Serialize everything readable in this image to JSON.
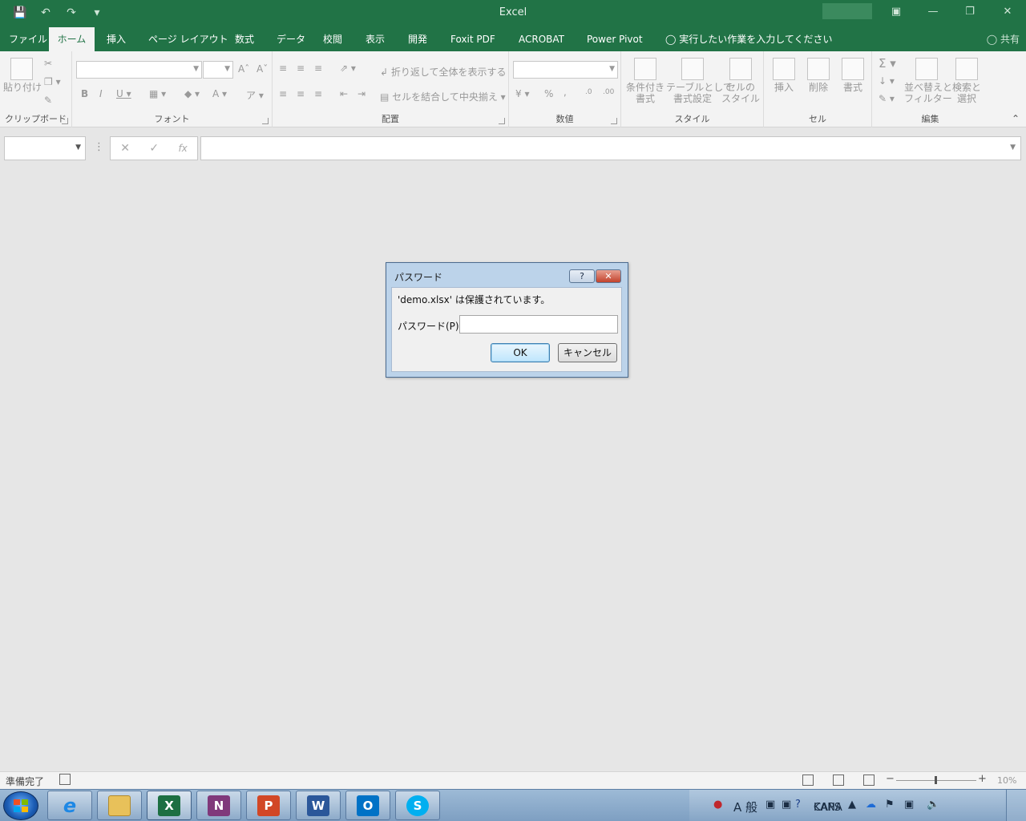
{
  "window": {
    "title": "Excel",
    "share_label": "共有"
  },
  "tabs": [
    "ファイル",
    "ホーム",
    "挿入",
    "ページ レイアウト",
    "数式",
    "データ",
    "校閲",
    "表示",
    "開発",
    "Foxit PDF",
    "ACROBAT",
    "Power Pivot",
    "実行したい作業を入力してください"
  ],
  "ribbon": {
    "clipboard": {
      "label": "クリップボード",
      "paste": "貼り付け"
    },
    "font": {
      "label": "フォント"
    },
    "alignment": {
      "label": "配置",
      "wrap": "折り返して全体を表示する",
      "merge": "セルを結合して中央揃え"
    },
    "number": {
      "label": "数値",
      "percent": "%",
      "comma": ","
    },
    "styles": {
      "label": "スタイル",
      "conditional_1": "条件付き",
      "conditional_2": "書式",
      "table_1": "テーブルとして",
      "table_2": "書式設定",
      "cell_1": "セルの",
      "cell_2": "スタイル"
    },
    "cells": {
      "label": "セル",
      "insert": "挿入",
      "delete": "削除",
      "format": "書式"
    },
    "editing": {
      "label": "編集",
      "sort_1": "並べ替えと",
      "sort_2": "フィルター",
      "find_1": "検索と",
      "find_2": "選択"
    }
  },
  "formula_bar": {
    "cancel": "✕",
    "enter": "✓",
    "fx": "fx"
  },
  "dialog": {
    "title": "パスワード",
    "help": "?",
    "close": "✕",
    "message": "'demo.xlsx' は保護されています。",
    "password_label": "パスワード(P):",
    "password_value": "",
    "ok": "OK",
    "cancel": "キャンセル"
  },
  "status": {
    "ready": "準備完了",
    "zoom": "10%",
    "minus": "−",
    "plus": "+"
  },
  "taskbar": {
    "apps": [
      {
        "name": "ie",
        "glyph": "e",
        "color": "#1e88e5"
      },
      {
        "name": "explorer",
        "glyph": "",
        "color": "#e8c15a"
      },
      {
        "name": "excel",
        "glyph": "X",
        "color": "#1d6f42"
      },
      {
        "name": "onenote",
        "glyph": "N",
        "color": "#80397b"
      },
      {
        "name": "powerpoint",
        "glyph": "P",
        "color": "#d24726"
      },
      {
        "name": "word",
        "glyph": "W",
        "color": "#2b579a"
      },
      {
        "name": "outlook",
        "glyph": "O",
        "color": "#0072c6"
      },
      {
        "name": "skype",
        "glyph": "S",
        "color": "#00aff0"
      }
    ],
    "ime": "A 般",
    "caps_1": "CAPS",
    "caps_2": "KANA"
  }
}
